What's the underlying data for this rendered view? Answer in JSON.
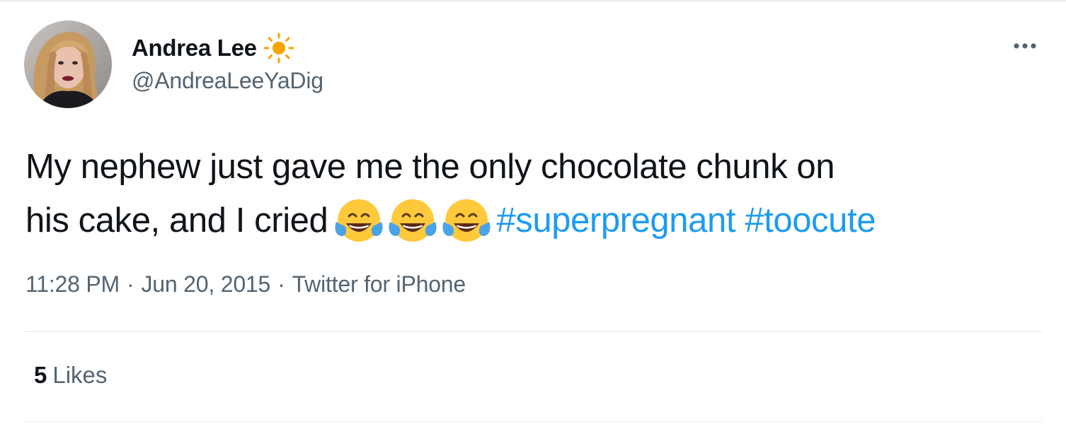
{
  "author": {
    "display_name": "Andrea Lee",
    "handle": "@AndreaLeeYaDig",
    "badge_icon": "sun-icon",
    "avatar_icon": "profile-photo"
  },
  "tweet": {
    "line1": "My nephew just gave me the only chocolate chunk on",
    "line2_prefix": "his cake, and I cried",
    "emoji_name": "face-with-tears-of-joy",
    "emoji_count": 3,
    "hashtags": [
      "#superpregnant",
      "#toocute"
    ]
  },
  "meta": {
    "time": "11:28 PM",
    "separator": "·",
    "date": "Jun 20, 2015",
    "source": "Twitter for iPhone"
  },
  "stats": {
    "likes_count": "5",
    "likes_label": "Likes"
  },
  "icons": {
    "more": "more-options-icon"
  },
  "colors": {
    "text": "#0f1419",
    "secondary": "#536471",
    "link": "#1d9bf0",
    "divider": "#eff3f4",
    "sun": "#f7a500"
  }
}
